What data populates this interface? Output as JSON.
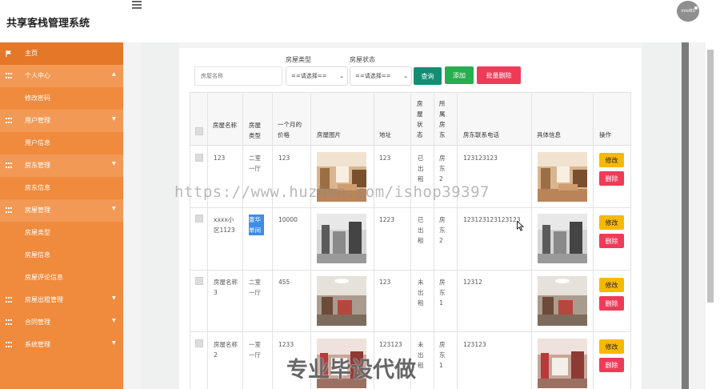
{
  "app": {
    "title": "共享客栈管理系统",
    "avatar_text": "mloIBS"
  },
  "sidebar": {
    "items": [
      {
        "label": "主页",
        "kind": "home",
        "icon": "flag-icon"
      },
      {
        "label": "个人中心",
        "kind": "group",
        "icon": "grid-icon",
        "caret": "▲"
      },
      {
        "label": "修改密码",
        "kind": "sub"
      },
      {
        "label": "用户管理",
        "kind": "group",
        "icon": "grid-icon",
        "caret": "▼"
      },
      {
        "label": "用户信息",
        "kind": "sub"
      },
      {
        "label": "房东管理",
        "kind": "group",
        "icon": "grid-icon",
        "caret": "▼"
      },
      {
        "label": "房东信息",
        "kind": "sub"
      },
      {
        "label": "房屋管理",
        "kind": "group",
        "icon": "grid-icon",
        "caret": "▼"
      },
      {
        "label": "房屋类型",
        "kind": "sub"
      },
      {
        "label": "房屋信息",
        "kind": "sub"
      },
      {
        "label": "房屋评论信息",
        "kind": "sub"
      },
      {
        "label": "房屋出租管理",
        "kind": "top",
        "icon": "grid-icon",
        "caret": "▼"
      },
      {
        "label": "合同管理",
        "kind": "top",
        "icon": "grid-icon",
        "caret": "▼"
      },
      {
        "label": "系统管理",
        "kind": "top",
        "icon": "grid-icon",
        "caret": "▼"
      }
    ]
  },
  "search": {
    "name_placeholder": "房屋名称",
    "type_label": "房屋类型",
    "type_value": "==请选择==",
    "status_label": "房屋状态",
    "status_value": "==请选择==",
    "query_label": "查询",
    "add_label": "添加",
    "batch_delete_label": "批量删除"
  },
  "table": {
    "headers": {
      "name": "房屋名称",
      "type": "房屋类型",
      "price": "一个月的价格",
      "image": "房屋图片",
      "address": "地址",
      "status": "房屋状态",
      "landlord": "所属房东",
      "phone": "房东联系电话",
      "detail": "具体信息",
      "actions": "操作"
    },
    "rows": [
      {
        "name": "123",
        "type": "二室一厅",
        "price": "123",
        "address": "123",
        "status": "已出租",
        "landlord": "房东2",
        "phone": "123123123"
      },
      {
        "name": "xxxx小区1123",
        "type": "豪华单间",
        "price": "10000",
        "address": "1223",
        "status": "已出租",
        "landlord": "房东2",
        "phone": "123123123123123"
      },
      {
        "name": "房屋名称3",
        "type": "二室一厅",
        "price": "455",
        "address": "123",
        "status": "未出租",
        "landlord": "房东1",
        "phone": "12312"
      },
      {
        "name": "房屋名称2",
        "type": "一室一厅",
        "price": "1233",
        "address": "123123",
        "status": "未出租",
        "landlord": "房东1",
        "phone": "123123"
      }
    ],
    "edit_label": "修改",
    "delete_label": "删除"
  },
  "overlay": {
    "watermark": "https://www.huzhan.com/ishop39397",
    "banner": "专业毕设代做"
  },
  "colors": {
    "sidebar": "#f08a3c",
    "query_button": "#138e73",
    "add_button": "#27ae4f",
    "danger": "#ef3b57",
    "warning": "#f7b900"
  }
}
